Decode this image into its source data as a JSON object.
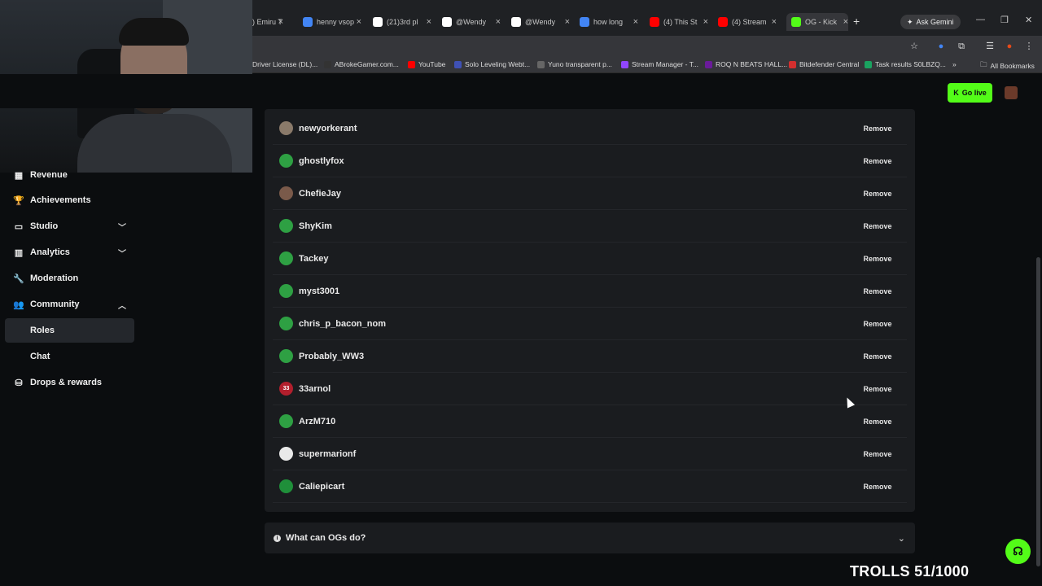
{
  "browser": {
    "tabs": [
      {
        "label": ") Emiru T",
        "color": "#9146ff"
      },
      {
        "label": "henny vsop",
        "color": "#4285f4"
      },
      {
        "label": "(21)3rd pl",
        "color": "#ffffff"
      },
      {
        "label": "@Wendy",
        "color": "#ffffff"
      },
      {
        "label": "@Wendy",
        "color": "#ffffff"
      },
      {
        "label": "how long",
        "color": "#4285f4"
      },
      {
        "label": "(4) This St",
        "color": "#ff0000"
      },
      {
        "label": "(4) Stream",
        "color": "#ff0000"
      },
      {
        "label": "OG - Kick",
        "color": "#53fc18"
      }
    ],
    "new_tab": "+",
    "ask_gemini": "Ask Gemini",
    "bookmarks": [
      {
        "label": "Driver License (DL)...",
        "color": "#888888"
      },
      {
        "label": "ABrokeGamer.com...",
        "color": "#333333"
      },
      {
        "label": "YouTube",
        "color": "#ff0000"
      },
      {
        "label": "Solo Leveling Webt...",
        "color": "#3f51b5"
      },
      {
        "label": "Yuno transparent p...",
        "color": "#666666"
      },
      {
        "label": "Stream Manager - T...",
        "color": "#9146ff"
      },
      {
        "label": "ROQ N BEATS HALL...",
        "color": "#6a1b9a"
      },
      {
        "label": "Bitdefender Central",
        "color": "#d32f2f"
      },
      {
        "label": "Task results S0LBZQ...",
        "color": "#1aa260"
      }
    ],
    "bookmarks_more": "»",
    "all_bookmarks": "All Bookmarks"
  },
  "header": {
    "go_live": "Go live"
  },
  "sidebar": {
    "items": [
      {
        "label": "Revenue",
        "icon": "dollar-icon",
        "glyph": "▦"
      },
      {
        "label": "Achievements",
        "icon": "trophy-icon",
        "glyph": "🏆"
      },
      {
        "label": "Studio",
        "icon": "studio-icon",
        "glyph": "▭",
        "chevron": "⌄"
      },
      {
        "label": "Analytics",
        "icon": "analytics-icon",
        "glyph": "▥",
        "chevron": "⌄"
      },
      {
        "label": "Moderation",
        "icon": "wrench-icon",
        "glyph": "🔧"
      },
      {
        "label": "Community",
        "icon": "community-icon",
        "glyph": "👥",
        "chevron": "⌃"
      },
      {
        "label": "Roles",
        "sub": true,
        "selected": true
      },
      {
        "label": "Chat",
        "sub": true
      },
      {
        "label": "Drops & rewards",
        "icon": "gift-icon",
        "glyph": "⛁"
      }
    ]
  },
  "og_list": {
    "remove_label": "Remove",
    "rows": [
      {
        "name": "newyorkerant",
        "avatar_color": "#8a7a6a",
        "avatar_text": ""
      },
      {
        "name": "ghostlyfox",
        "avatar_color": "#2ea043",
        "avatar_text": ""
      },
      {
        "name": "ChefieJay",
        "avatar_color": "#7a5a4a",
        "avatar_text": ""
      },
      {
        "name": "ShyKim",
        "avatar_color": "#2ea043",
        "avatar_text": ""
      },
      {
        "name": "Tackey",
        "avatar_color": "#2ea043",
        "avatar_text": ""
      },
      {
        "name": "myst3001",
        "avatar_color": "#2ea043",
        "avatar_text": ""
      },
      {
        "name": "chris_p_bacon_nom",
        "avatar_color": "#2ea043",
        "avatar_text": ""
      },
      {
        "name": "Probably_WW3",
        "avatar_color": "#2ea043",
        "avatar_text": ""
      },
      {
        "name": "33arnol",
        "avatar_color": "#b21f2d",
        "avatar_text": "33"
      },
      {
        "name": "ArzM710",
        "avatar_color": "#2ea043",
        "avatar_text": ""
      },
      {
        "name": "supermarionf",
        "avatar_color": "#e9e9e9",
        "avatar_text": ""
      },
      {
        "name": "Caliepicart",
        "avatar_color": "#1f8f3a",
        "avatar_text": ""
      }
    ]
  },
  "faq": {
    "question": "What can OGs do?"
  },
  "overlay": {
    "trolls": "TROLLS 51/1000"
  }
}
